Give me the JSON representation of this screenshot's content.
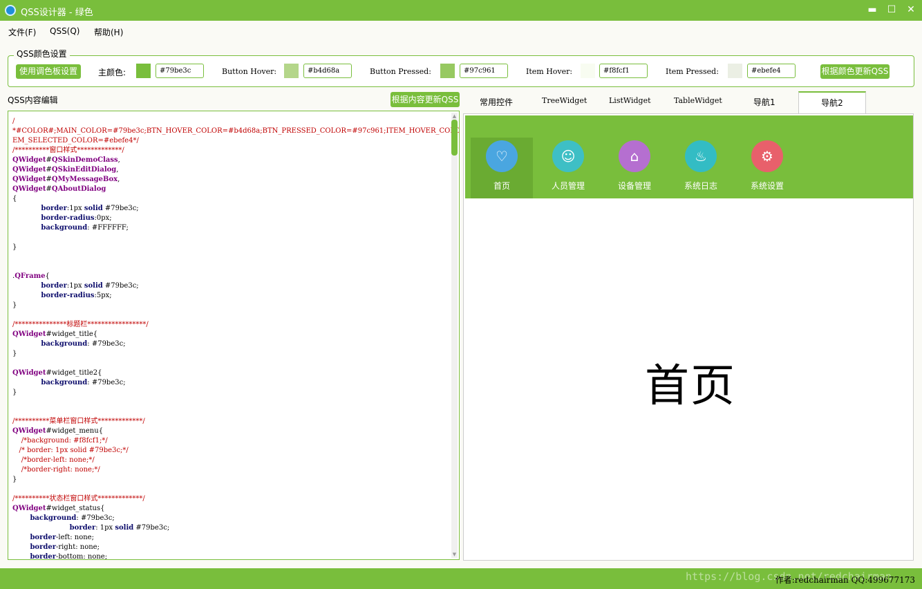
{
  "window": {
    "title": "QSS设计器 - 绿色",
    "minimize": "▬",
    "maximize": "☐",
    "close": "✕"
  },
  "menu": [
    "文件(F)",
    "QSS(Q)",
    "帮助(H)"
  ],
  "color_settings": {
    "group_title": "QSS颜色设置",
    "palette_button": "使用调色板设置",
    "main_color_label": "主颜色:",
    "main_color_value": "#79be3c",
    "button_hover_label": "Button Hover:",
    "button_hover_value": "#b4d68a",
    "button_pressed_label": "Button Pressed:",
    "button_pressed_value": "#97c961",
    "item_hover_label": "Item Hover:",
    "item_hover_value": "#f8fcf1",
    "item_pressed_label": "Item Pressed:",
    "item_pressed_value": "#ebefe4",
    "update_by_color_button": "根据颜色更新QSS"
  },
  "editor": {
    "label": "QSS内容编辑",
    "update_by_content_button": "根据内容更新QSS"
  },
  "tabs": [
    "常用控件",
    "TreeWidget",
    "ListWidget",
    "TableWidget",
    "导航1",
    "导航2"
  ],
  "nav": {
    "items": [
      {
        "label": "首页",
        "icon": "heart-icon",
        "color": "#4aa6e0"
      },
      {
        "label": "人员管理",
        "icon": "user-icon",
        "color": "#3ebfc5"
      },
      {
        "label": "设备管理",
        "icon": "home-icon",
        "color": "#b56fd0"
      },
      {
        "label": "系统日志",
        "icon": "log-icon",
        "color": "#33bcc4"
      },
      {
        "label": "系统设置",
        "icon": "settings-icon",
        "color": "#e8606b"
      }
    ],
    "page_title": "首页"
  },
  "status": {
    "watermark": "https://blog.csdn.net/redchairman",
    "author": "作者:redchairman QQ:499677173"
  }
}
